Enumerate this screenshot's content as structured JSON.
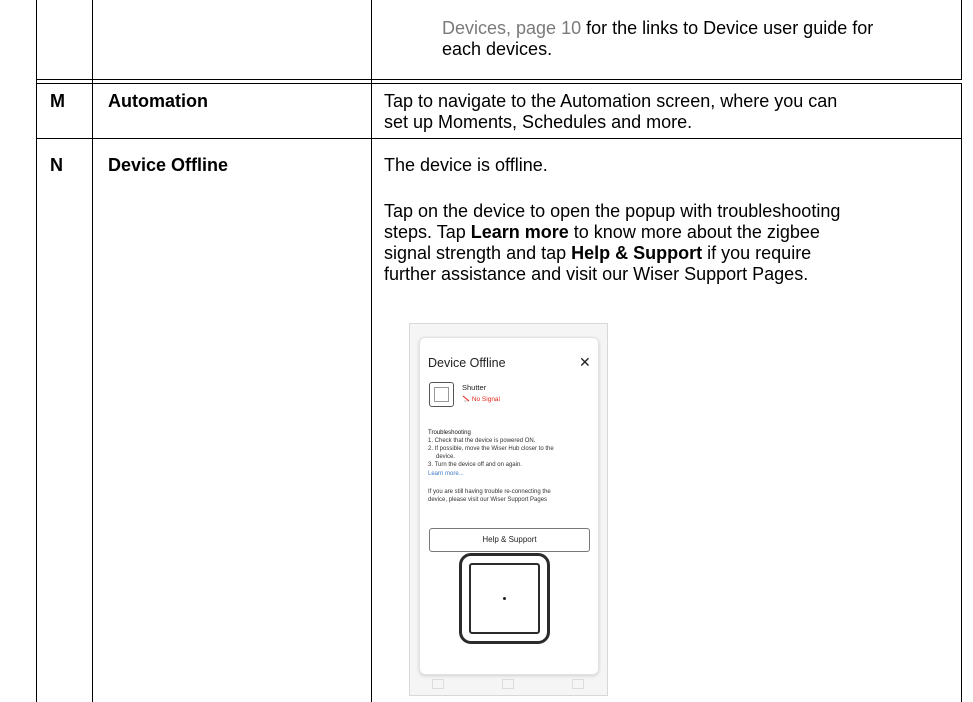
{
  "top_row": {
    "link_text": "Devices, page 10",
    "text_after_link": " for the links to Device user guide for",
    "text_line2": "each devices."
  },
  "rows": [
    {
      "key": "M",
      "title": "Automation",
      "desc_line1": "Tap to navigate to the Automation screen, where you can",
      "desc_line2": "set up Moments, Schedules and more."
    },
    {
      "key": "N",
      "title": "Device Offline",
      "desc_p1": "The device is offline.",
      "desc_p2": {
        "l1": "Tap on the device to open the popup with troubleshooting",
        "l2_a": "steps. Tap ",
        "l2_b": "Learn more",
        "l2_c": " to know more about the zigbee",
        "l3_a": "signal strength and tap ",
        "l3_b": "Help & Support",
        "l3_c": " if you require",
        "l4": "further assistance and visit our Wiser Support Pages."
      }
    }
  ],
  "popup": {
    "title": "Device Offline",
    "close_glyph": "✕",
    "device_name": "Shutter",
    "signal_status": "No Signal",
    "signal_icon": "no-signal-icon",
    "troubleshooting_heading": "Troubleshooting",
    "step1": "1. Check that the device is powered ON.",
    "step2a": "2. If possible, move the Wiser Hub closer to the",
    "step2b": "device.",
    "step3": "3. Turn the device off and on again.",
    "learn_more": "Learn more...",
    "support_text1": "If you are still having trouble re-connecting the",
    "support_text2": "device, please visit our Wiser Support Pages",
    "help_button": "Help & Support",
    "accent_color": "#e1251b",
    "link_color": "#3d7ac9"
  }
}
